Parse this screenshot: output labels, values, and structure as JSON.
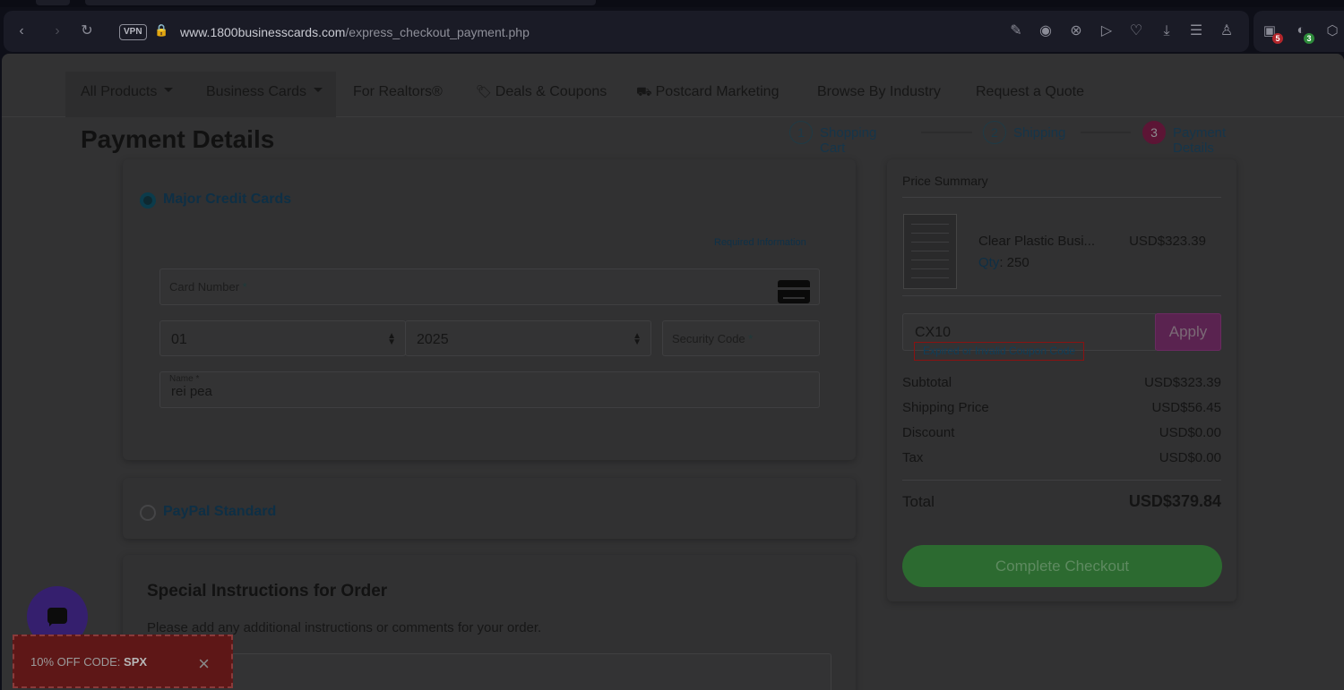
{
  "browser": {
    "vpn_label": "VPN",
    "url_domain": "www.1800businesscards.com",
    "url_path": "/express_checkout_payment.php",
    "ext_badge_1": "5",
    "ext_badge_2": "3"
  },
  "nav": {
    "items": [
      {
        "label": "All Products"
      },
      {
        "label": "Business Cards"
      },
      {
        "label": "For Realtors®"
      },
      {
        "label": "Deals & Coupons"
      },
      {
        "label": "Postcard Marketing"
      },
      {
        "label": "Browse By Industry"
      },
      {
        "label": "Request a Quote"
      }
    ]
  },
  "page_title": "Payment Details",
  "steps": [
    {
      "num": "1",
      "label": "Shopping Cart"
    },
    {
      "num": "2",
      "label": "Shipping"
    },
    {
      "num": "3",
      "label": "Payment Details"
    }
  ],
  "payment": {
    "method_cards": "Major Credit Cards",
    "required_info": "Required Information",
    "card_number_label": "Card Number",
    "star": "*",
    "month_value": "01",
    "year_value": "2025",
    "security_label": "Security Code",
    "name_label": "Name",
    "name_value": "rei pea",
    "method_paypal": "PayPal Standard"
  },
  "instructions": {
    "title": "Special Instructions for Order",
    "text": "Please add any additional instructions or comments for your order."
  },
  "summary": {
    "title": "Price Summary",
    "product_name": "Clear Plastic Busi...",
    "product_price": "USD$323.39",
    "qty_label": "Qty",
    "qty_value": ": 250",
    "coupon_value": "CX10",
    "apply_label": "Apply",
    "coupon_error": "Expired or Invalid Coupon Code",
    "rows": [
      {
        "label": "Subtotal",
        "value": "USD$323.39"
      },
      {
        "label": "Shipping Price",
        "value": "USD$56.45"
      },
      {
        "label": "Discount",
        "value": "USD$0.00"
      },
      {
        "label": "Tax",
        "value": "USD$0.00"
      }
    ],
    "total_label": "Total",
    "total_value": "USD$379.84",
    "checkout_label": "Complete Checkout"
  },
  "promo": {
    "prefix": "10% OFF CODE: ",
    "code": "SPX",
    "close": "×"
  },
  "icons": {
    "back": "back-arrow-icon",
    "forward": "forward-arrow-icon",
    "reload": "reload-icon",
    "lock": "lock-icon",
    "chat": "chat-icon",
    "card": "credit-card-icon"
  }
}
